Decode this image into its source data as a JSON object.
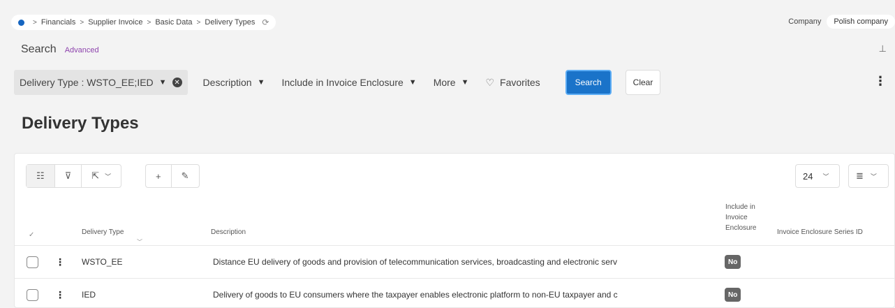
{
  "breadcrumb": {
    "items": [
      "Financials",
      "Supplier Invoice",
      "Basic Data",
      "Delivery Types"
    ],
    "separator": ">"
  },
  "company": {
    "label": "Company",
    "value": "Polish company"
  },
  "search": {
    "title": "Search",
    "advanced": "Advanced"
  },
  "filters": {
    "chip_label": "Delivery Type : WSTO_EE;IED",
    "description": "Description",
    "include_enclosure": "Include in Invoice Enclosure",
    "more": "More",
    "favorites": "Favorites",
    "search_button": "Search",
    "clear_button": "Clear"
  },
  "page_title": "Delivery Types",
  "toolbar": {
    "page_size": "24"
  },
  "table": {
    "columns": {
      "delivery_type": "Delivery Type",
      "description": "Description",
      "include_enclosure": "Include in Invoice Enclosure",
      "series_id": "Invoice Enclosure Series ID"
    },
    "rows": [
      {
        "delivery_type": "WSTO_EE",
        "description": "Distance EU delivery of goods and provision of telecommunication services, broadcasting and electronic serv",
        "include_enclosure": "No"
      },
      {
        "delivery_type": "IED",
        "description": "Delivery of goods to EU consumers where the taxpayer enables electronic platform to non-EU taxpayer and c",
        "include_enclosure": "No"
      }
    ]
  },
  "colors": {
    "accent": "#1a73c9",
    "advanced_link": "#8e44ad",
    "badge": "#666666"
  }
}
